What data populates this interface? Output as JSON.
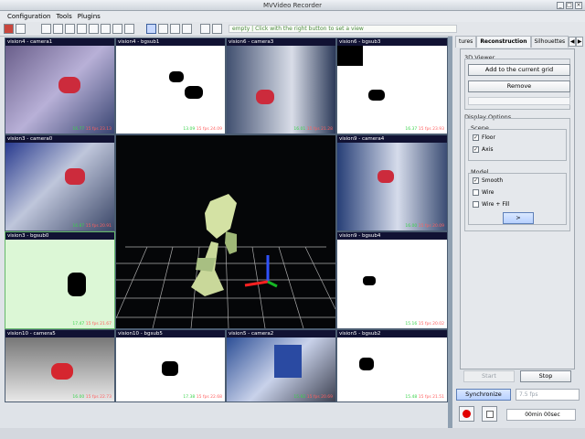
{
  "window": {
    "title": "MVVideo Recorder",
    "buttons": [
      "_",
      "□",
      "×"
    ]
  },
  "menus": [
    "Configuration",
    "Tools",
    "Plugins"
  ],
  "toolbar": {
    "hint": "empty | Click with the right button to set a view"
  },
  "videos": [
    {
      "label": "vision4 - camera1",
      "footer_green": "16.77",
      "footer_red": "15 fps",
      "footer_rest": "23.13"
    },
    {
      "label": "vision4 - bgsub1",
      "footer_green": "13.09",
      "footer_red": "15 fps",
      "footer_rest": "24.09"
    },
    {
      "label": "vision6 - camera3",
      "footer_green": "16.01",
      "footer_red": "15 fps",
      "footer_rest": "21.28"
    },
    {
      "label": "vision6 - bgsub3",
      "footer_green": "16.37",
      "footer_red": "15 fps",
      "footer_rest": "23.93"
    },
    {
      "label": "vision3 - camera0",
      "footer_green": "16.87",
      "footer_red": "15 fps",
      "footer_rest": "20.91"
    },
    {
      "label": "vision9 - camera4",
      "footer_green": "16.00",
      "footer_red": "15 fps",
      "footer_rest": "20.09"
    },
    {
      "label": "vision3 - bgsub0",
      "footer_green": "17.47",
      "footer_red": "15 fps",
      "footer_rest": "21.67"
    },
    {
      "label": "vision9 - bgsub4",
      "footer_green": "15.16",
      "footer_red": "15 fps",
      "footer_rest": "20.02"
    },
    {
      "label": "vision10 - camera5",
      "footer_green": "16.00",
      "footer_red": "15 fps",
      "footer_rest": "22.73"
    },
    {
      "label": "vision10 - bgsub5",
      "footer_green": "17.38",
      "footer_red": "15 fps",
      "footer_rest": "22.68"
    },
    {
      "label": "vision5 - camera2",
      "footer_green": "15.92",
      "footer_red": "15 fps",
      "footer_rest": "20.69"
    },
    {
      "label": "vision5 - bgsub2",
      "footer_green": "15.48",
      "footer_red": "15 fps",
      "footer_rest": "21.51"
    }
  ],
  "panel": {
    "tabs": [
      "tures",
      "Reconstruction",
      "Silhouettes"
    ],
    "viewer_title": "3D Viewer",
    "add_button": "Add to the current grid",
    "remove_button": "Remove",
    "display_options": "Display Options",
    "scene_title": "Scene",
    "floor": "Floor",
    "axis": "Axis",
    "model_title": "Model",
    "smooth": "Smooth",
    "wire": "Wire",
    "wirefill": "Wire + Fill",
    "arrow_button": ">",
    "start_button": "Start",
    "stop_button": "Stop",
    "sync_button": "Synchronize",
    "fps_placeholder": "7.5 fps",
    "timer": "00min 00sec"
  },
  "colors": {
    "accent": "#5d7fb8",
    "selected_border": "#65b86a",
    "record": "#e10000"
  }
}
